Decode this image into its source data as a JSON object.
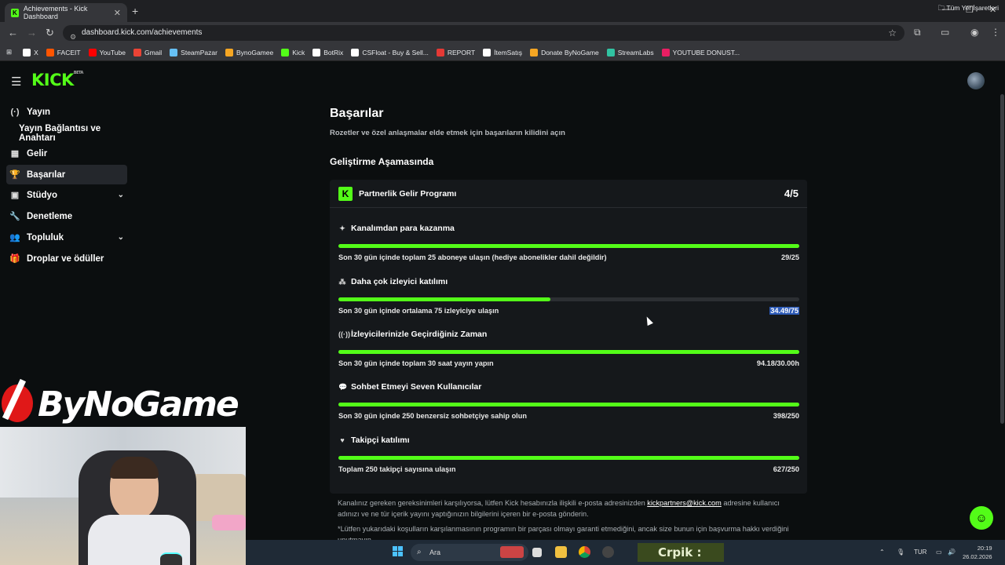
{
  "browser": {
    "tab_title": "Achievements - Kick Dashboard",
    "url": "dashboard.kick.com/achievements",
    "bookmarks": [
      {
        "label": "X",
        "color": "#ffffff"
      },
      {
        "label": "FACEIT",
        "color": "#ff5500"
      },
      {
        "label": "YouTube",
        "color": "#ff0000"
      },
      {
        "label": "Gmail",
        "color": "#ea4335"
      },
      {
        "label": "SteamPazar",
        "color": "#66c0f4"
      },
      {
        "label": "BynoGamee",
        "color": "#f5a623"
      },
      {
        "label": "Kick",
        "color": "#53fc18"
      },
      {
        "label": "BotRix",
        "color": "#ffffff"
      },
      {
        "label": "CSFloat - Buy & Sell...",
        "color": "#ffffff"
      },
      {
        "label": "REPORT",
        "color": "#e53935"
      },
      {
        "label": "İtemSatış",
        "color": "#ffffff"
      },
      {
        "label": "Donate ByNoGame",
        "color": "#f5a623"
      },
      {
        "label": "StreamLabs",
        "color": "#31c3a2"
      },
      {
        "label": "YOUTUBE DONUST...",
        "color": "#e91e63"
      }
    ],
    "bookmarks_all": "Tüm Yer İşaretleri"
  },
  "app": {
    "logo": "KICK",
    "logo_badge": "BETA",
    "accent": "#53fc18"
  },
  "sidebar": {
    "items": [
      {
        "label": "Yayın",
        "icon": "broadcast-icon",
        "glyph": "(·)"
      },
      {
        "label": "Yayın Bağlantısı ve Anahtarı",
        "icon": "",
        "glyph": ""
      },
      {
        "label": "Gelir",
        "icon": "revenue-icon",
        "glyph": "▦"
      },
      {
        "label": "Başarılar",
        "icon": "trophy-icon",
        "glyph": "🏆"
      },
      {
        "label": "Stüdyo",
        "icon": "studio-icon",
        "glyph": "▣"
      },
      {
        "label": "Denetleme",
        "icon": "moderation-icon",
        "glyph": "🔧"
      },
      {
        "label": "Topluluk",
        "icon": "community-icon",
        "glyph": "👥"
      },
      {
        "label": "Droplar ve ödüller",
        "icon": "drops-icon",
        "glyph": "🎁"
      }
    ]
  },
  "main": {
    "title": "Başarılar",
    "subtitle": "Rozetler ve özel anlaşmalar elde etmek için başarıların kilidini açın",
    "section": "Geliştirme Aşamasında",
    "card": {
      "badge": "K",
      "title": "Partnerlik Gelir Programı",
      "count": "4/5",
      "requirements": [
        {
          "title": "Kanalımdan para kazanma",
          "icon": "sparkle-icon",
          "glyph": "✦",
          "desc": "Son 30 gün içinde toplam 25 aboneye ulaşın (hediye abonelikler dahil değildir)",
          "value": "29/25",
          "progress": 1.0
        },
        {
          "title": "Daha çok izleyici katılımı",
          "icon": "viewers-icon",
          "glyph": "⁂",
          "desc": "Son 30 gün içinde ortalama 75 izleyiciye ulaşın",
          "value": "34.49/75",
          "progress": 0.46
        },
        {
          "title": "İzleyicilerinizle Geçirdiğiniz Zaman",
          "icon": "live-icon",
          "glyph": "((·))",
          "desc": "Son 30 gün içinde toplam 30 saat yayın yapın",
          "value": "94.18/30.00h",
          "progress": 1.0
        },
        {
          "title": "Sohbet Etmeyi Seven Kullanıcılar",
          "icon": "chat-icon",
          "glyph": "💬",
          "desc": "Son 30 gün içinde 250 benzersiz sohbetçiye sahip olun",
          "value": "398/250",
          "progress": 1.0
        },
        {
          "title": "Takipçi katılımı",
          "icon": "heart-icon",
          "glyph": "♥",
          "desc": "Toplam 250 takipçi sayısına ulaşın",
          "value": "627/250",
          "progress": 1.0
        }
      ]
    },
    "footer_pre": "Kanalınız gereken gereksinimleri karşılıyorsa, lütfen Kick hesabınızla ilişkili e-posta adresinizden ",
    "footer_link": "kickpartners@kick.com",
    "footer_post": " adresine kullanıcı adınızı ve ne tür içerik yayını yaptığınızın bilgilerini içeren bir e-posta gönderin.",
    "footer_note": "*Lütfen yukarıdaki koşulların karşılanmasının programın bir parçası olmayı garanti etmediğini, ancak size bunun için başvurma hakkı verdiğini unutmayın."
  },
  "overlay": {
    "brand": "ByNoGame"
  },
  "taskbar": {
    "search_placeholder": "Ara",
    "game_text": "Crpik :",
    "lang": "TUR",
    "time": "20:19",
    "date": "26.02.2026"
  }
}
